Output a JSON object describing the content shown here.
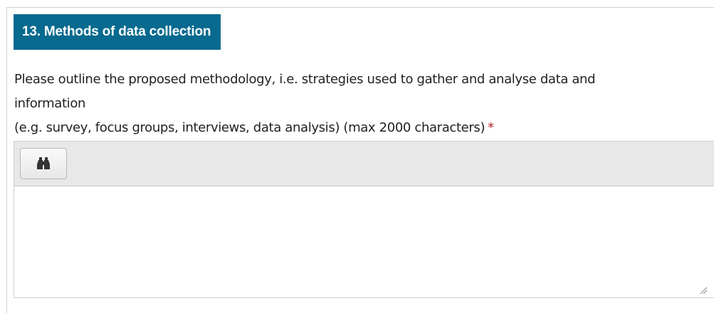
{
  "section": {
    "title": "13. Methods of data collection"
  },
  "question": {
    "line1": "Please outline the proposed methodology, i.e. strategies used to gather and analyse data and",
    "line2": "information",
    "line3": "(e.g. survey, focus groups, interviews, data analysis) (max 2000 characters)",
    "required_marker": "*"
  },
  "editor": {
    "toolbar_icon": "binoculars-icon",
    "value": ""
  },
  "colors": {
    "header_bg": "#076a8e",
    "required": "#b22222"
  }
}
